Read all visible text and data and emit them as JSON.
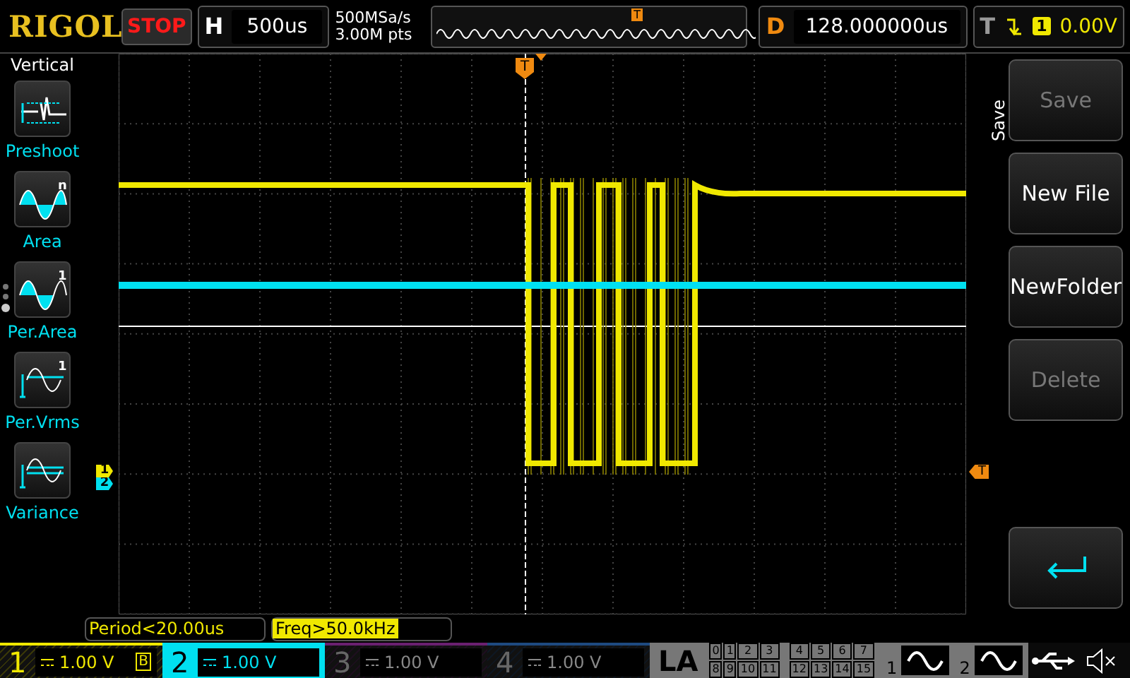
{
  "header": {
    "logo": "RIGOL",
    "run_state": "STOP",
    "horizontal": {
      "label": "H",
      "timebase": "500us"
    },
    "sample_rate": "500MSa/s",
    "memory_depth": "3.00M pts",
    "timeline_marker": "T",
    "delay": {
      "label": "D",
      "value": "128.000000us"
    },
    "trigger": {
      "label": "T",
      "source": "1",
      "level": "0.00V"
    }
  },
  "measure_menu": {
    "title": "Vertical",
    "items": [
      {
        "label": "Preshoot",
        "kind": "preshoot"
      },
      {
        "label": "Area",
        "kind": "area",
        "icon_badge": "n"
      },
      {
        "label": "Per.Area",
        "kind": "per_area",
        "icon_badge": "1"
      },
      {
        "label": "Per.Vrms",
        "kind": "per_vrms",
        "icon_badge": "1"
      },
      {
        "label": "Variance",
        "kind": "variance"
      }
    ],
    "pages": [
      {
        "selected": false
      },
      {
        "selected": false
      },
      {
        "selected": true
      }
    ]
  },
  "screen": {
    "channel_markers": [
      {
        "label": "1",
        "color": "#f0e800"
      },
      {
        "label": "2",
        "color": "#00e0f0"
      }
    ],
    "trigger_position_marker": "T",
    "trigger_level_marker": "T"
  },
  "side_menu": {
    "title": "Save",
    "buttons": [
      {
        "kind": "text",
        "label": "Save",
        "disabled": true
      },
      {
        "kind": "text",
        "label": "New File",
        "disabled": false
      },
      {
        "kind": "text",
        "label": "NewFolder",
        "disabled": false
      },
      {
        "kind": "text",
        "label": "Delete",
        "disabled": true
      },
      {
        "kind": "back",
        "disabled": false
      }
    ]
  },
  "counters": [
    {
      "text": "Period<20.00us",
      "highlighted": false
    },
    {
      "text": "Freq>50.0kHz",
      "highlighted": true
    }
  ],
  "channels": [
    {
      "number": "1",
      "scale": "1.00 V",
      "enabled": true,
      "selected": false,
      "color": "#f0e800",
      "bandwidth_limit": "B"
    },
    {
      "number": "2",
      "scale": "1.00 V",
      "enabled": true,
      "selected": true,
      "color": "#00e0f0"
    },
    {
      "number": "3",
      "scale": "1.00 V",
      "enabled": false,
      "selected": false,
      "color": "#6a2070"
    },
    {
      "number": "4",
      "scale": "1.00 V",
      "enabled": false,
      "selected": false,
      "color": "#1e4a80"
    }
  ],
  "logic_analyzer": {
    "label": "LA",
    "channels": [
      "0",
      "1",
      "2",
      "3",
      "4",
      "5",
      "6",
      "7",
      "8",
      "9",
      "10",
      "11",
      "12",
      "13",
      "14",
      "15"
    ]
  },
  "generators": [
    {
      "label": "1"
    },
    {
      "label": "2"
    }
  ]
}
